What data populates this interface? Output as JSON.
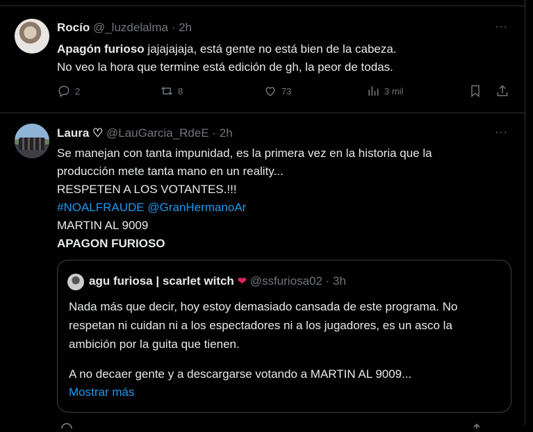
{
  "tweet1": {
    "name": "Rocío",
    "handle": "@_luzdelalma",
    "time": "· 2h",
    "more": "···",
    "line1_bold": "Apagón furioso",
    "line1_rest": " jajajajaja, está gente no está bien de la cabeza.",
    "line2": "No veo la hora que termine está edición de gh, la peor de todas.",
    "replies": "2",
    "reposts": "8",
    "likes": "73",
    "views": "3 mil"
  },
  "tweet2": {
    "name": "Laura ♡",
    "handle": "@LauGarcia_RdeE",
    "time": "· 2h",
    "more": "···",
    "line1": "Se manejan con tanta  impunidad, es la primera vez en la historia que la",
    "line2": "producción mete tanta mano en un reality...",
    "line3": "RESPETEN A LOS VOTANTES.!!!",
    "hashtag": "#NOALFRAUDE",
    "mention": "@GranHermanoAr",
    "line5": "MARTIN AL 9009",
    "line6": "APAGON FURIOSO",
    "quote": {
      "name": "agu furiosa | scarlet witch",
      "handle": "@ssfuriosa02",
      "time": "· 3h",
      "line1": "Nada más que decir, hoy estoy demasiado cansada de este programa. No",
      "line2": "respetan ni cuidan ni a los espectadores ni a los jugadores, es un asco la",
      "line3": "ambición por la guita que tienen.",
      "line4": "A no decaer gente y a descargarse votando a MARTIN AL 9009...",
      "show_more": "Mostrar más"
    }
  },
  "colors": {
    "background": "#000000",
    "text": "#e7e9ea",
    "muted": "#71767b",
    "link": "#1d9bf0",
    "border": "#2f3336"
  },
  "icons": [
    "more-icon",
    "reply-icon",
    "repost-icon",
    "like-icon",
    "views-icon",
    "bookmark-icon",
    "share-icon",
    "heart-fire-icon"
  ]
}
